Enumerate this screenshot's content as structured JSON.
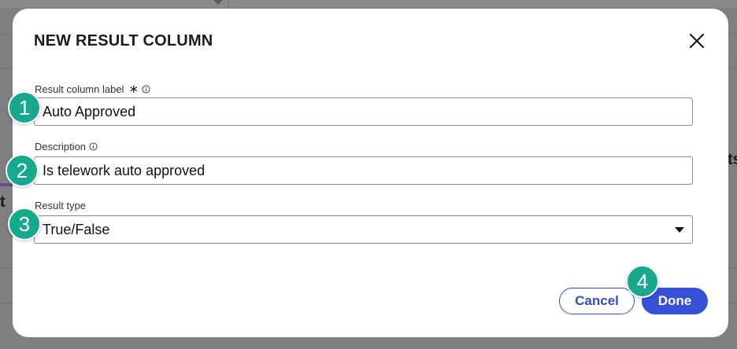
{
  "background": {
    "fragment_right": "ts",
    "fragment_left": "t"
  },
  "dialog": {
    "title": "NEW RESULT COLUMN",
    "close_icon": "close-icon",
    "fields": {
      "label": {
        "label": "Result column label",
        "required_mark": "∗",
        "value": "Auto Approved"
      },
      "description": {
        "label": "Description",
        "value": "Is telework auto approved"
      },
      "result_type": {
        "label": "Result type",
        "value": "True/False"
      }
    },
    "buttons": {
      "cancel": "Cancel",
      "done": "Done"
    }
  },
  "steps": [
    "1",
    "2",
    "3",
    "4"
  ],
  "colors": {
    "accent": "#3650d8",
    "step_badge": "#17a88d"
  }
}
